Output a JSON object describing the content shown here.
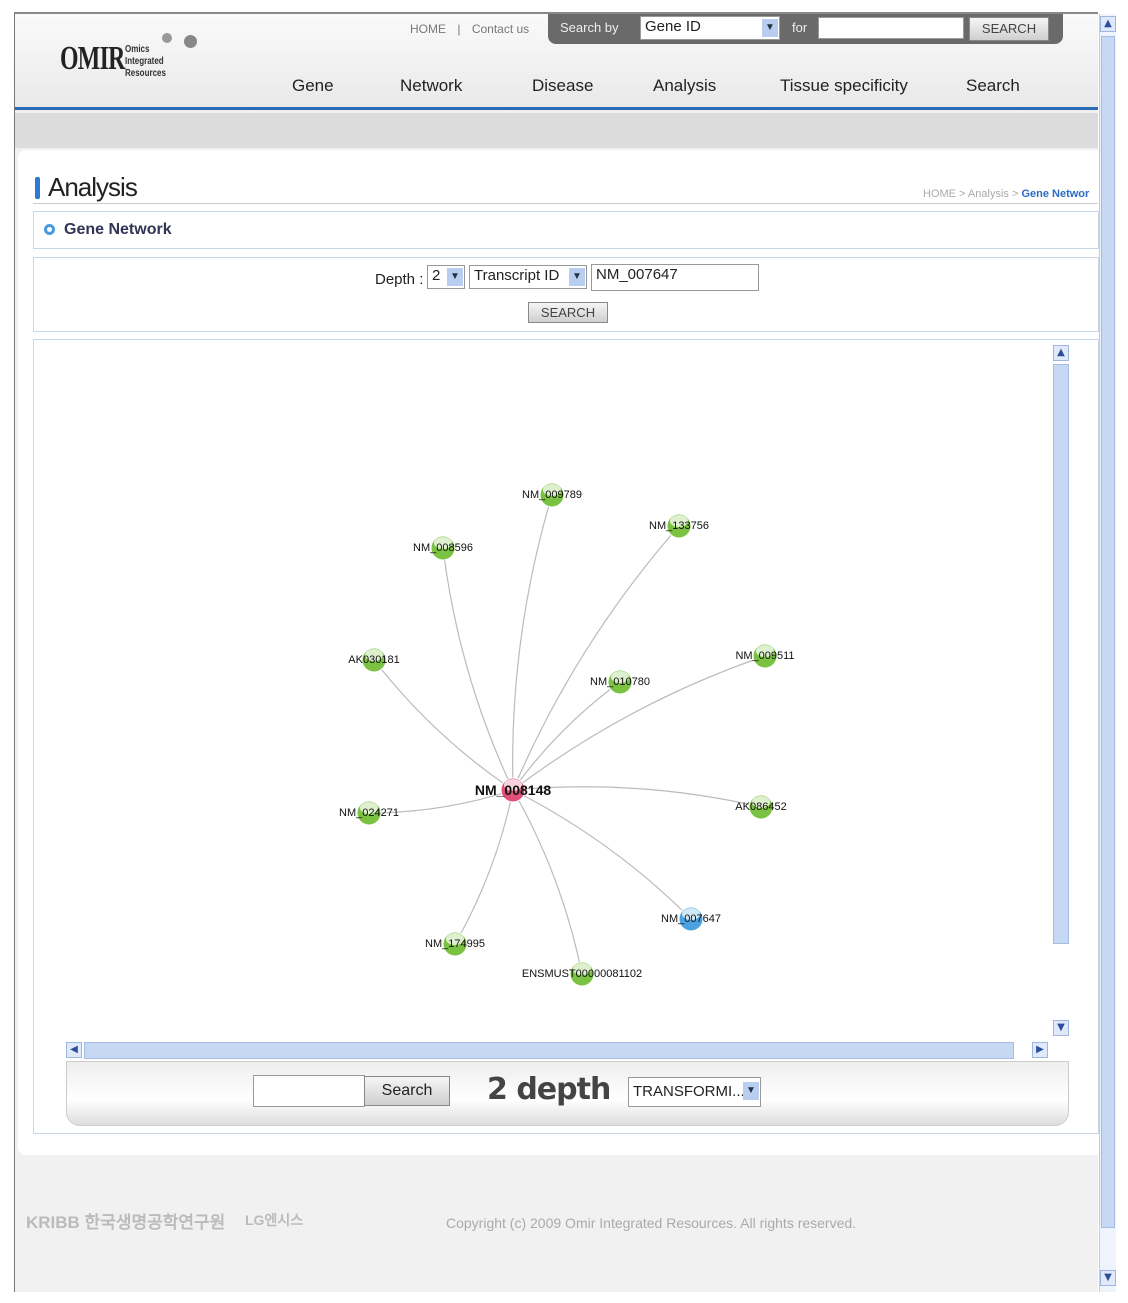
{
  "header": {
    "logo": "OMIR",
    "logo_sub": [
      "Omics",
      "Integrated",
      "Resources"
    ],
    "top_links": [
      "HOME",
      "Contact us"
    ],
    "search_by_label": "Search by",
    "search_by_value": "Gene ID",
    "for_label": "for",
    "search_value": "",
    "search_button": "SEARCH",
    "nav": [
      "Gene",
      "Network",
      "Disease",
      "Analysis",
      "Tissue specificity",
      "Search"
    ]
  },
  "page": {
    "title": "Analysis",
    "breadcrumb": "HOME > Analysis > ",
    "breadcrumb_current": "Gene Networ",
    "section": "Gene Network"
  },
  "form": {
    "depth_label": "Depth :",
    "depth_value": "2",
    "id_type": "Transcript ID",
    "id_value": "NM_007647",
    "search_button": "SEARCH"
  },
  "network": {
    "center": "NM_008148",
    "colors": {
      "center": "#e0507a",
      "query": "#4aa3e0",
      "neighbor": "#7cc242"
    },
    "nodes": [
      {
        "label": "NM_009789",
        "type": "neighbor"
      },
      {
        "label": "NM_133756",
        "type": "neighbor"
      },
      {
        "label": "NM_008596",
        "type": "neighbor"
      },
      {
        "label": "AK030181",
        "type": "neighbor"
      },
      {
        "label": "NM_009511",
        "type": "neighbor"
      },
      {
        "label": "NM_010780",
        "type": "neighbor"
      },
      {
        "label": "NM_024271",
        "type": "neighbor"
      },
      {
        "label": "AK086452",
        "type": "neighbor"
      },
      {
        "label": "NM_007647",
        "type": "query"
      },
      {
        "label": "NM_174995",
        "type": "neighbor"
      },
      {
        "label": "ENSMUST00000081102",
        "type": "neighbor"
      }
    ]
  },
  "toolbar": {
    "search_value": "",
    "search_button": "Search",
    "depth_text": "2 depth",
    "filter_value": "TRANSFORMI..."
  },
  "footer": {
    "org1": "KRIBB 한국생명공학연구원",
    "org2": "LG엔시스",
    "copyright": "Copyright (c) 2009 Omir Integrated Resources. All rights reserved."
  }
}
